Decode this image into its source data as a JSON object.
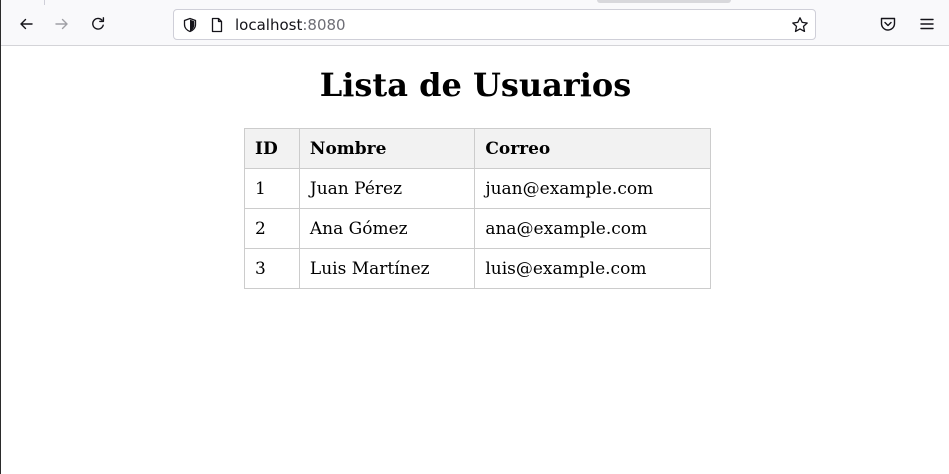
{
  "browser": {
    "url_host": "localhost",
    "url_port": ":8080",
    "icons": {
      "back": "arrow-left-icon",
      "forward": "arrow-right-icon",
      "reload": "reload-icon",
      "tracking": "shield-icon",
      "page": "page-icon",
      "bookmark": "star-icon",
      "pocket": "pocket-icon",
      "menu": "hamburger-menu-icon"
    }
  },
  "page": {
    "title": "Lista de Usuarios",
    "table": {
      "headers": [
        "ID",
        "Nombre",
        "Correo"
      ],
      "rows": [
        [
          "1",
          "Juan Pérez",
          "juan@example.com"
        ],
        [
          "2",
          "Ana Gómez",
          "ana@example.com"
        ],
        [
          "3",
          "Luis Martínez",
          "luis@example.com"
        ]
      ]
    }
  },
  "colors": {
    "toolbar_bg": "#f9f9fb",
    "header_bg": "#f2f2f2",
    "border": "#cccccc"
  }
}
